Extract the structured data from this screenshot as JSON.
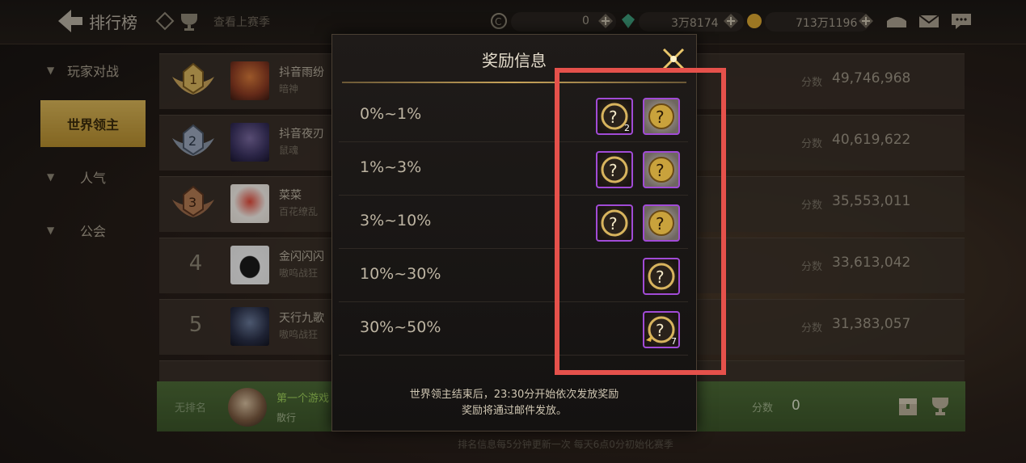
{
  "topbar": {
    "title": "排行榜",
    "season_link": "查看上赛季",
    "currency_1": "0",
    "currency_2": "3万8174",
    "currency_3": "713万1196"
  },
  "sidebar": {
    "items": [
      {
        "label": "玩家对战"
      },
      {
        "label": "世界领主"
      },
      {
        "label": "人气"
      },
      {
        "label": "公会"
      }
    ]
  },
  "ranking": {
    "score_label": "分数",
    "rows": [
      {
        "rank": "1",
        "name": "抖音雨纷",
        "guild": "暗神",
        "score": "49,746,968"
      },
      {
        "rank": "2",
        "name": "抖音夜刃",
        "guild": "鼠魂",
        "score": "40,619,622"
      },
      {
        "rank": "3",
        "name": "菜菜",
        "guild": "百花缭乱",
        "score": "35,553,011"
      },
      {
        "rank": "4",
        "name": "金闪闪闪",
        "guild": "嗷呜战狂",
        "score": "33,613,042"
      },
      {
        "rank": "5",
        "name": "天行九歌",
        "guild": "嗷呜战狂",
        "score": "31,383,057"
      }
    ]
  },
  "self": {
    "rank": "无排名",
    "name": "第一个游戏",
    "title": "散行",
    "score_label": "分数",
    "score": "0"
  },
  "footer_note": "排名信息每5分钟更新一次 每天6点0分初始化赛季",
  "modal": {
    "title": "奖励信息",
    "tiers": [
      {
        "label": "0%~1%",
        "items": [
          {
            "type": "chest",
            "count": "2"
          },
          {
            "type": "box",
            "count": ""
          }
        ]
      },
      {
        "label": "1%~3%",
        "items": [
          {
            "type": "chest",
            "count": ""
          },
          {
            "type": "box",
            "count": ""
          }
        ]
      },
      {
        "label": "3%~10%",
        "items": [
          {
            "type": "chest",
            "count": ""
          },
          {
            "type": "box",
            "count": ""
          }
        ]
      },
      {
        "label": "10%~30%",
        "items": [
          {
            "type": "chest",
            "count": ""
          }
        ]
      },
      {
        "label": "30%~50%",
        "items": [
          {
            "type": "fragment",
            "count": "7"
          }
        ]
      }
    ],
    "note_line1": "世界领主结束后，23:30分开始依次发放奖励",
    "note_line2": "奖励将通过邮件发放。"
  },
  "colors": {
    "accent_gold": "#c9a45a",
    "annotation_red": "#e5514b",
    "item_border_purple": "#a14bd6"
  }
}
